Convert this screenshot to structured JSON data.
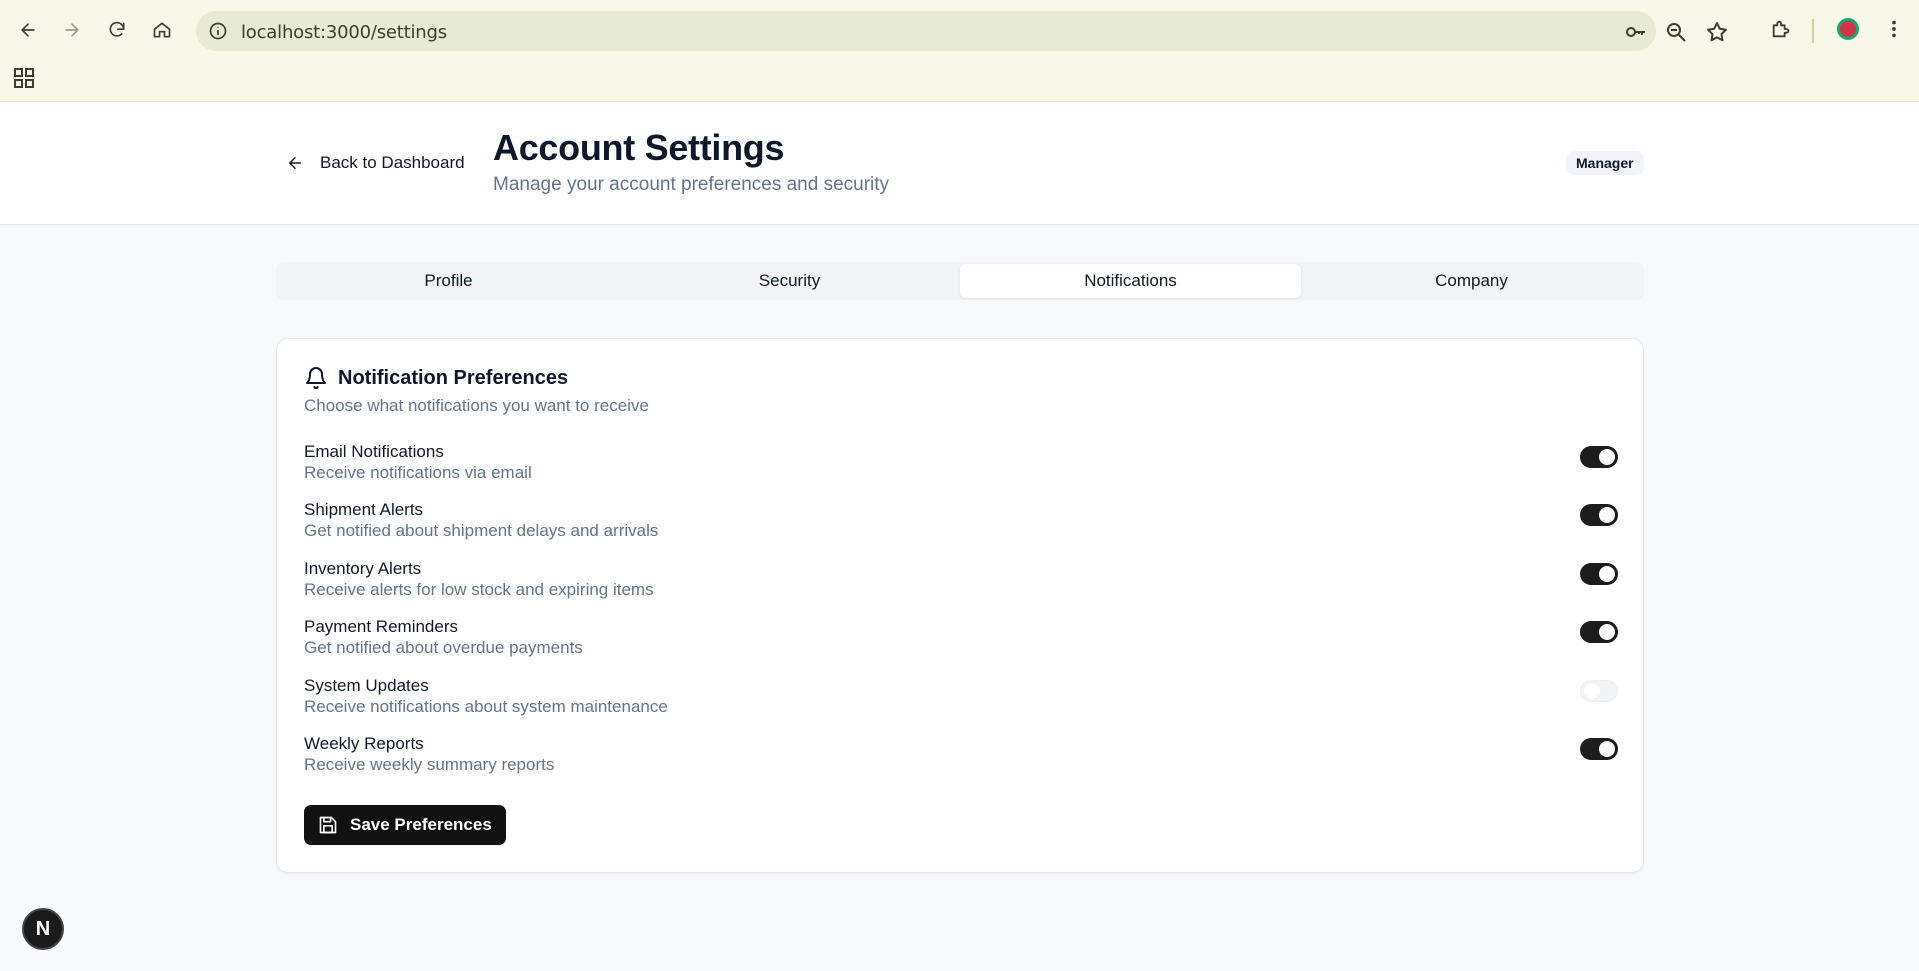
{
  "browser": {
    "url": "localhost:3000/settings"
  },
  "header": {
    "back_label": "Back to Dashboard",
    "title": "Account Settings",
    "subtitle": "Manage your account preferences and security",
    "role_badge": "Manager"
  },
  "tabs": [
    {
      "label": "Profile",
      "active": false
    },
    {
      "label": "Security",
      "active": false
    },
    {
      "label": "Notifications",
      "active": true
    },
    {
      "label": "Company",
      "active": false
    }
  ],
  "card": {
    "title": "Notification Preferences",
    "description": "Choose what notifications you want to receive",
    "preferences": [
      {
        "label": "Email Notifications",
        "description": "Receive notifications via email",
        "enabled": true
      },
      {
        "label": "Shipment Alerts",
        "description": "Get notified about shipment delays and arrivals",
        "enabled": true
      },
      {
        "label": "Inventory Alerts",
        "description": "Receive alerts for low stock and expiring items",
        "enabled": true
      },
      {
        "label": "Payment Reminders",
        "description": "Get notified about overdue payments",
        "enabled": true
      },
      {
        "label": "System Updates",
        "description": "Receive notifications about system maintenance",
        "enabled": false
      },
      {
        "label": "Weekly Reports",
        "description": "Receive weekly summary reports",
        "enabled": true
      }
    ],
    "save_label": "Save Preferences"
  },
  "dev_badge": "N",
  "colors": {
    "toggle_on": "#1c1c1c",
    "toggle_off": "#f1f3f5",
    "primary_button": "#111111"
  }
}
